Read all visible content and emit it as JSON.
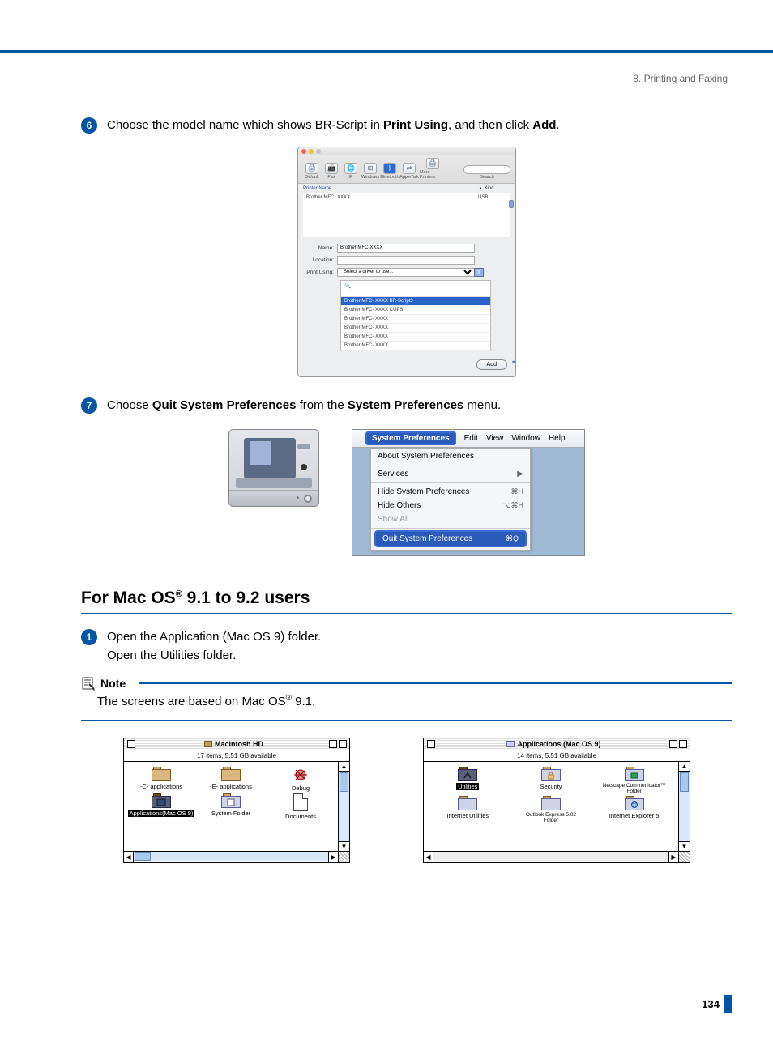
{
  "header": {
    "breadcrumb": "8. Printing and Faxing"
  },
  "steps": {
    "s6": {
      "num": "6",
      "pre": "Choose the model name which shows BR-Script in ",
      "b1": "Print Using",
      "mid": ", and then click ",
      "b2": "Add",
      "post": "."
    },
    "s7": {
      "num": "7",
      "pre": "Choose ",
      "b1": "Quit System Preferences",
      "mid": " from the ",
      "b2": "System Preferences",
      "post": " menu."
    },
    "s1b": {
      "num": "1",
      "line1": "Open the Application (Mac OS 9) folder.",
      "line2": "Open the Utilities folder."
    }
  },
  "fig6": {
    "toolbar": {
      "items": [
        "Default",
        "Fax",
        "IP",
        "Windows",
        "Bluetooth",
        "AppleTalk",
        "More Printers"
      ],
      "search_label": "Search",
      "search_placeholder": ""
    },
    "listhead": {
      "name": "Printer Name",
      "kind": "Kind"
    },
    "listrow": {
      "name": "Brother MFC- XXXX",
      "kind": "USB"
    },
    "form": {
      "name_label": "Name:",
      "name_value": "Brother MFC-XXXX",
      "loc_label": "Location:",
      "loc_value": "",
      "using_label": "Print Using:",
      "using_value": "Select a driver to use..."
    },
    "drivers": {
      "search_placeholder": "",
      "selected": "Brother MFC- XXXX   BR-Script3",
      "others": [
        "Brother MFC- XXXX  CUPS",
        "Brother MFC- XXXX",
        "Brother MFC- XXXX",
        "Brother MFC- XXXX",
        "Brother MFC- XXXX"
      ]
    },
    "add_btn": "Add"
  },
  "fig7": {
    "menubar": {
      "active": "System Preferences",
      "items": [
        "Edit",
        "View",
        "Window",
        "Help"
      ]
    },
    "menu": {
      "about": "About System Preferences",
      "services": "Services",
      "hide": "Hide System Preferences",
      "hide_sc": "⌘H",
      "hide_others": "Hide Others",
      "hide_others_sc": "⌥⌘H",
      "show_all": "Show All",
      "quit": "Quit System Preferences",
      "quit_sc": "⌘Q"
    }
  },
  "section_heading": {
    "pre": "For Mac OS",
    "sup": "®",
    "post": " 9.1 to 9.2 users"
  },
  "note": {
    "label": "Note",
    "body_pre": "The screens are based on Mac OS",
    "body_sup": "®",
    "body_post": " 9.1."
  },
  "os9": {
    "left": {
      "title": "Macintosh HD",
      "info": "17 items, 5.51 GB available",
      "items": [
        {
          "label": "-C- applications",
          "type": "folder"
        },
        {
          "label": "-E- applications",
          "type": "folder"
        },
        {
          "label": "Debug",
          "type": "debug"
        },
        {
          "label": "Applications(Mac OS 9)",
          "type": "app",
          "selected": true
        },
        {
          "label": "System Folder",
          "type": "sys"
        },
        {
          "label": "Documents",
          "type": "doc"
        }
      ]
    },
    "right": {
      "title": "Applications (Mac OS 9)",
      "info": "14 items, 5.51 GB available",
      "items": [
        {
          "label": "Utilities",
          "type": "util",
          "selected": true
        },
        {
          "label": "Security",
          "type": "app"
        },
        {
          "label": "Netscape Communicator™ Folder",
          "type": "app"
        },
        {
          "label": "Internet Utilities",
          "type": "app"
        },
        {
          "label": "Outlook Express 5.02 Folder",
          "type": "app"
        },
        {
          "label": "Internet Explorer 5",
          "type": "app"
        }
      ]
    }
  },
  "page_number": "134"
}
